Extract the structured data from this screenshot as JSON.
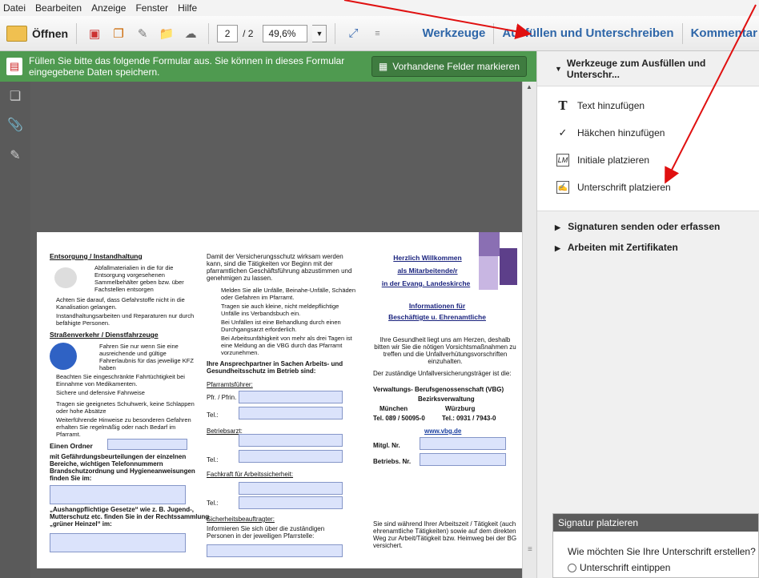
{
  "menu": {
    "items": [
      "Datei",
      "Bearbeiten",
      "Anzeige",
      "Fenster",
      "Hilfe"
    ]
  },
  "toolbar": {
    "open_label": "Öffnen",
    "page_current": "2",
    "page_total": "/ 2",
    "zoom": "49,6%",
    "werkzeuge": "Werkzeuge",
    "fill_sign": "Ausfüllen und Unterschreiben",
    "comment": "Kommentar"
  },
  "infobar": {
    "text": "Füllen Sie bitte das folgende Formular aus. Sie können in dieses Formular eingegebene Daten speichern.",
    "button": "Vorhandene Felder markieren"
  },
  "sidepanel": {
    "header": "Werkzeuge zum Ausfüllen und Unterschr...",
    "tools": [
      "Text hinzufügen",
      "Häkchen hinzufügen",
      "Initiale platzieren",
      "Unterschrift platzieren"
    ],
    "collapsed": [
      "Signaturen senden oder erfassen",
      "Arbeiten mit Zertifikaten"
    ],
    "icons": [
      "T",
      "✓",
      "LM",
      "✍"
    ]
  },
  "sigdialog": {
    "title": "Signatur platzieren",
    "question": "Wie möchten Sie Ihre Unterschrift erstellen?",
    "option1": "Unterschrift eintippen"
  },
  "doc": {
    "col1": {
      "h1": "Entsorgung / Instandhaltung",
      "p1": "Abfallmaterialien in die für die Entsorgung vorgesehenen Sammelbehälter geben bzw. über Fachstellen entsorgen",
      "p2": "Achten Sie darauf, dass Gefahrstoffe nicht in die Kanalisation gelangen.",
      "p3": "Instandhaltungsarbeiten und Reparaturen nur durch befähigte Personen.",
      "h2": "Straßenverkehr / Dienstfahrzeuge",
      "p4": "Fahren Sie nur wenn Sie eine ausreichende und gültige Fahrerlaubnis für das jeweilige KFZ haben",
      "p5": "Beachten Sie eingeschränkte Fahrtüchtigkeit bei Einnahme von Medikamenten.",
      "p6": "Sichere und defensive Fahrweise",
      "p7": "Tragen sie geeignetes Schuhwerk, keine Schlappen oder hohe Absätze",
      "p8": "Weiterführende Hinweise zu besonderen Gefahren erhalten Sie regelmäßig oder nach Bedarf im Pfarramt.",
      "ordner": "Einen Ordner",
      "ordner_text": "mit Gefährdungsbeurteilungen der einzelnen Bereiche, wichtigen Telefonnummern Brandschutzordnung und Hygieneanweisungen finden Sie im:",
      "gesetze": "„Aushangpflichtige Gesetze“ wie z. B. Jugend-, Mutterschutz etc. finden Sie in der Rechtssammlung „grüner Heinzel“ im:"
    },
    "col2": {
      "intro": "Damit der Versicherungsschutz wirksam werden kann, sind die Tätigkeiten vor Beginn mit der pfarramtlichen Geschäftsführung abzustimmen und genehmigen zu lassen.",
      "b1": "Melden Sie alle Unfälle, Beinahe-Unfälle, Schäden oder Gefahren im Pfarramt.",
      "b2": "Tragen sie auch kleine, nicht meldepflichtige Unfälle ins Verbandsbuch ein.",
      "b3": "Bei Unfällen ist eine Behandlung durch einen Durchgangsarzt erforderlich.",
      "b4": "Bei Arbeitsunfähigkeit von mehr als drei Tagen ist eine Meldung an die VBG durch das Pfarramt vorzunehmen.",
      "partner": "Ihre Ansprechpartner in Sachen Arbeits- und Gesundheitsschutz im Betrieb sind:",
      "pfarramt": "Pfarramtsführer:",
      "pfr": "Pfr. / Pfrin.",
      "tel": "Tel.:",
      "arzt": "Betriebsarzt:",
      "fachkraft": "Fachkraft für Arbeitssicherheit:",
      "sib": "Sicherheitsbeauftragter:",
      "sib_text": "Informieren Sie sich über die zuständigen Personen in der jeweiligen Pfarrstelle:"
    },
    "col3": {
      "w1": "Herzlich Willkommen",
      "w2": "als Mitarbeitende/r",
      "w3": "in der Evang. Landeskirche",
      "i1": "Informationen für",
      "i2": "Beschäftigte u. Ehrenamtliche",
      "health": "Ihre Gesundheit liegt uns am Herzen, deshalb bitten wir Sie die nötigen Vorsichtsmaßnahmen zu treffen und die Unfallverhütungsvorschriften einzuhalten.",
      "traeger": "Der zuständige Unfallversicherungsträger ist die:",
      "vbg": "Verwaltungs- Berufsgenossenschaft (VBG)",
      "bezirk": "Bezirksverwaltung",
      "muc": "München",
      "wue": "Würzburg",
      "tel_muc": "Tel. 089 / 50095-0",
      "tel_wue": "Tel.: 0931 / 7943-0",
      "web": "www.vbg.de",
      "mitgl": "Mitgl. Nr.",
      "betriebs": "Betriebs. Nr.",
      "footer": "Sie sind während Ihrer Arbeitszeit / Tätigkeit (auch ehrenamtliche Tätigkeiten) sowie auf dem direkten Weg zur Arbeit/Tätigkeit bzw. Heimweg bei der BG versichert."
    }
  },
  "colors": {
    "infobar": "#4f9a50",
    "nav": "#2e66a8",
    "arrow": "#e01010"
  }
}
